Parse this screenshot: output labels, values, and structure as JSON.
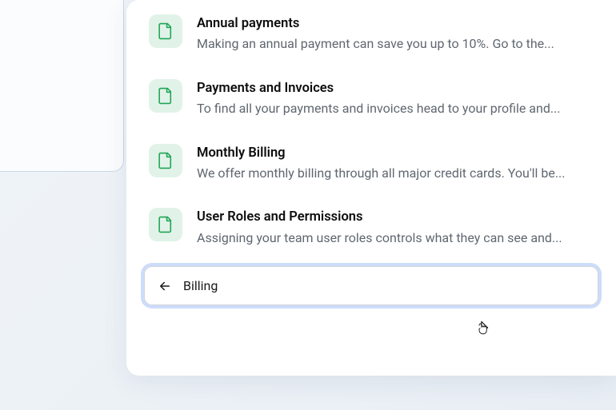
{
  "results": [
    {
      "title": "Annual payments",
      "description": "Making an annual payment can save you up to 10%. Go to the..."
    },
    {
      "title": "Payments and Invoices",
      "description": "To find all your payments and invoices head to your profile and..."
    },
    {
      "title": "Monthly Billing",
      "description": "We offer monthly billing through all major credit cards. You'll be..."
    },
    {
      "title": "User Roles and Permissions",
      "description": "Assigning your team user roles controls what they can see and..."
    }
  ],
  "search": {
    "value": "Billing"
  },
  "colors": {
    "icon_bg": "#e1f3e8",
    "icon_stroke": "#20a556",
    "focus_ring": "rgba(90, 140, 240, 0.3)"
  }
}
